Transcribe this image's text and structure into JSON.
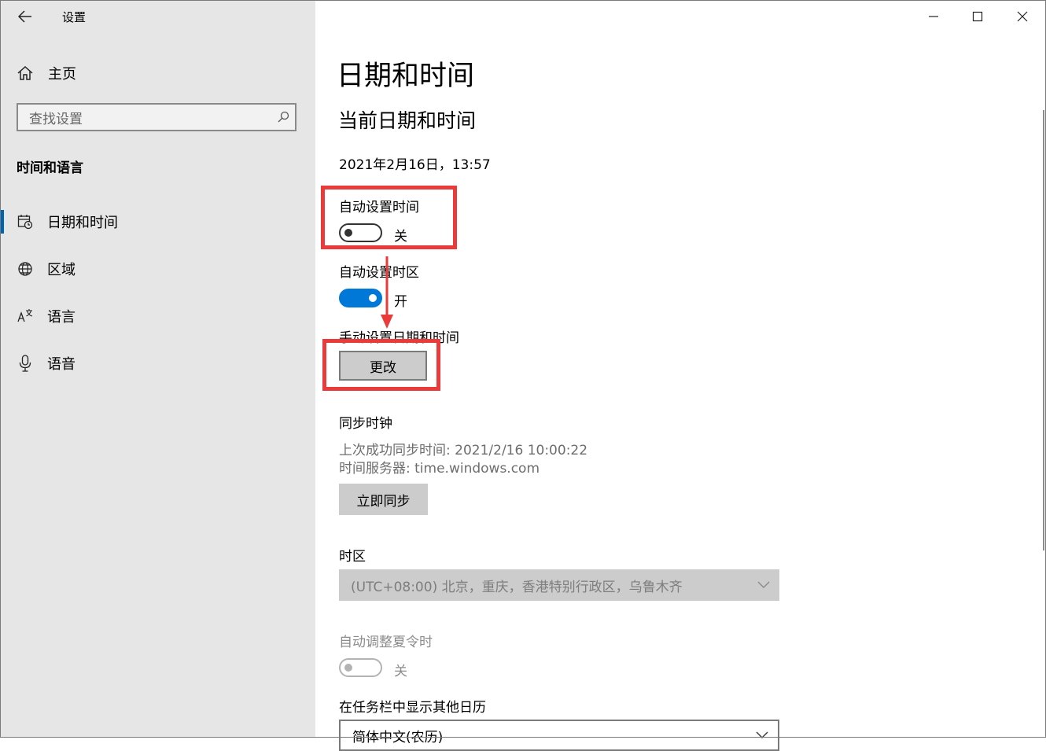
{
  "window": {
    "title": "设置"
  },
  "sidebar": {
    "home_label": "主页",
    "search_placeholder": "查找设置",
    "section_title": "时间和语言",
    "items": [
      {
        "label": "日期和时间",
        "icon": "calendar-clock-icon",
        "selected": true
      },
      {
        "label": "区域",
        "icon": "globe-icon",
        "selected": false
      },
      {
        "label": "语言",
        "icon": "language-icon",
        "selected": false
      },
      {
        "label": "语音",
        "icon": "microphone-icon",
        "selected": false
      }
    ]
  },
  "main": {
    "page_title": "日期和时间",
    "section_title": "当前日期和时间",
    "current_datetime": "2021年2月16日，13:57",
    "auto_time": {
      "label": "自动设置时间",
      "state_text": "关",
      "on": false
    },
    "auto_timezone": {
      "label": "自动设置时区",
      "state_text": "开",
      "on": true
    },
    "manual": {
      "label": "手动设置日期和时间",
      "button": "更改"
    },
    "sync": {
      "label": "同步时钟",
      "last_sync": "上次成功同步时间: 2021/2/16 10:00:22",
      "server": "时间服务器: time.windows.com",
      "button": "立即同步"
    },
    "timezone": {
      "label": "时区",
      "value": "(UTC+08:00) 北京，重庆，香港特别行政区，乌鲁木齐"
    },
    "dst": {
      "label": "自动调整夏令时",
      "state_text": "关",
      "on": false,
      "disabled": true
    },
    "calendar": {
      "label": "在任务栏中显示其他日历",
      "value": "简体中文(农历)"
    }
  },
  "colors": {
    "accent": "#0078d7",
    "annotation_red": "#ea3a3a",
    "sidebar_bg": "#e6e6e6"
  }
}
